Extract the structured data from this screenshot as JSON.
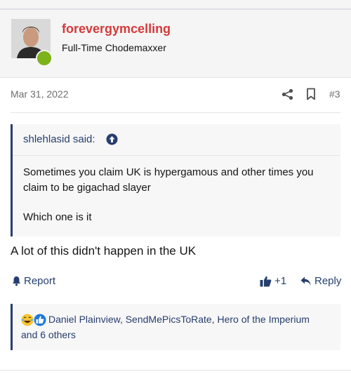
{
  "post": {
    "username": "forevergymcelling",
    "user_title": "Full-Time Chodemaxxer",
    "date": "Mar 31, 2022",
    "post_number": "#3",
    "quote": {
      "author": "shlehlasid said:",
      "text_line1": "Sometimes you claim UK is hypergamous and other times you claim to be gigachad slayer",
      "text_line2": "Which one is it"
    },
    "message": "A lot of this didn't happen in the UK",
    "actions": {
      "report": "Report",
      "like_count": "+1",
      "reply": "Reply"
    },
    "reactions": {
      "names": "Daniel Plainview, SendMePicsToRate, Hero of the Imperium",
      "others": "and 6 others"
    }
  },
  "colors": {
    "accent": "#263e6e",
    "username": "#d43a3a",
    "online": "#7cb21a"
  },
  "icons": [
    "share-icon",
    "bookmark-icon",
    "arrow-up-circle-icon",
    "bell-icon",
    "thumbs-up-icon",
    "reply-arrow-icon",
    "laughing-emoji-icon",
    "like-reaction-icon"
  ]
}
